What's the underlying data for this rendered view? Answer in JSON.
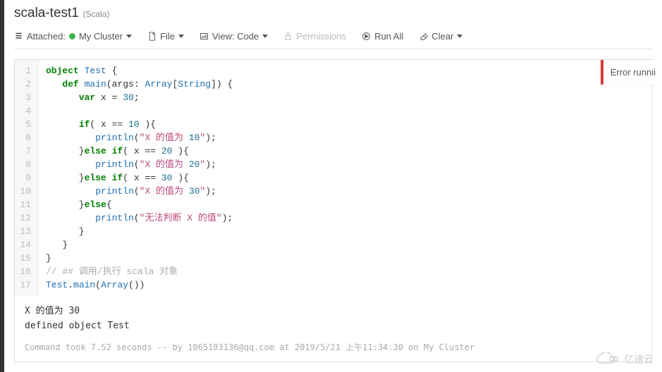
{
  "header": {
    "title": "scala-test1",
    "language": "(Scala)"
  },
  "toolbar": {
    "attached_label": "Attached:",
    "cluster_name": "My Cluster",
    "file_label": "File",
    "view_label": "View: Code",
    "permissions_label": "Permissions",
    "run_all_label": "Run All",
    "clear_label": "Clear"
  },
  "error_banner": "Error runnii",
  "code_lines": [
    "object Test {",
    "   def main(args: Array[String]) {",
    "      var x = 30;",
    "",
    "      if( x == 10 ){",
    "         println(\"X 的值为 10\");",
    "      }else if( x == 20 ){",
    "         println(\"X 的值为 20\");",
    "      }else if( x == 30 ){",
    "         println(\"X 的值为 30\");",
    "      }else{",
    "         println(\"无法判断 X 的值\");",
    "      }",
    "   }",
    "}",
    "// ## 调用/执行 scala 对象",
    "Test.main(Array())"
  ],
  "output": {
    "line1": "X 的值为 30",
    "line2": "defined object Test"
  },
  "meta": "Command took 7.52 seconds -- by 1065183136@qq.com at 2019/5/21 上午11:34:30 on My Cluster",
  "watermark": "亿速云"
}
